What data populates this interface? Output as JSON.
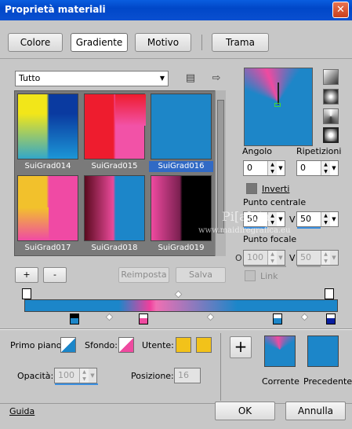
{
  "window": {
    "title": "Proprietà materiali",
    "close_glyph": "✕"
  },
  "tabs": [
    {
      "label": "Colore"
    },
    {
      "label": "Gradiente"
    },
    {
      "label": "Motivo"
    },
    {
      "label": "Trama"
    }
  ],
  "category": {
    "selected": "Tutto"
  },
  "gallery": {
    "items": [
      {
        "label": "SuiGrad014",
        "colors": [
          "#f2e619",
          "#0a3aa0"
        ]
      },
      {
        "label": "SuiGrad015",
        "colors": [
          "#ee1c2e",
          "#f252a7"
        ]
      },
      {
        "label": "SuiGrad016",
        "colors": [
          "#1d86c8",
          "#ef4aa0"
        ],
        "selected": true
      },
      {
        "label": "SuiGrad017",
        "colors": [
          "#f2c12c",
          "#f04aa4"
        ]
      },
      {
        "label": "SuiGrad018",
        "colors": [
          "#5a0a1e",
          "#1c86c9"
        ]
      },
      {
        "label": "SuiGrad019",
        "colors": [
          "#ef4aa0",
          "#000000"
        ]
      }
    ]
  },
  "buttons": {
    "add": "+",
    "remove": "-",
    "reset": "Reimposta",
    "save": "Salva"
  },
  "angle": {
    "label": "Angolo",
    "value": "0"
  },
  "repeat": {
    "label": "Ripetizioni",
    "value": "0"
  },
  "invert": {
    "label": "Inverti"
  },
  "center_point": {
    "label": "Punto centrale",
    "h_value": "50",
    "v_label": "V",
    "v_value": "50"
  },
  "focal_point": {
    "label": "Punto focale",
    "o_label": "O",
    "h_value": "100",
    "v_label": "V",
    "v_value": "50"
  },
  "link": {
    "label": "Link"
  },
  "foreground": {
    "label": "Primo piano:"
  },
  "background": {
    "label": "Sfondo:"
  },
  "user": {
    "label": "Utente:"
  },
  "opacity": {
    "label": "Opacità:",
    "value": "100"
  },
  "position": {
    "label": "Posizione:",
    "value": "16"
  },
  "current": {
    "label": "Corrente"
  },
  "previous": {
    "label": "Precedente"
  },
  "footer": {
    "help": "Guida",
    "ok": "OK",
    "cancel": "Annulla"
  },
  "watermark": {
    "line1": "Pi[a]cia",
    "line2": "www.maidiregrafica.eu"
  },
  "colors": {
    "accent_blue": "#1c86c9",
    "accent_pink": "#ef4aa0",
    "user_yellow": "#f2c21a"
  },
  "icons": {
    "close": "close-icon",
    "options": "notepad-icon",
    "arrow": "arrow-right-icon",
    "plus": "plus-icon"
  }
}
